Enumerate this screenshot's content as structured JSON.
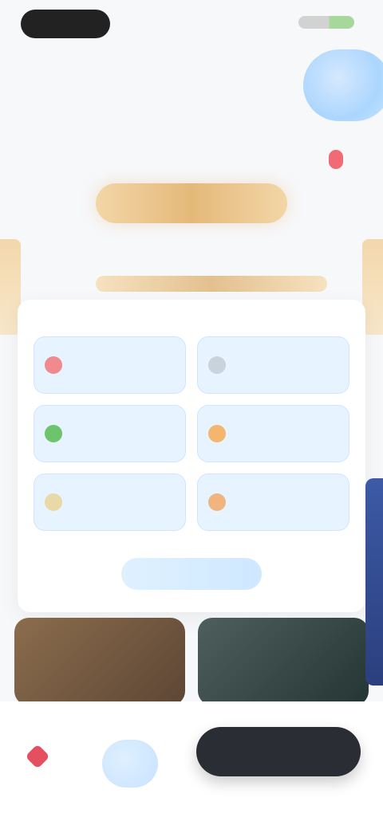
{
  "header": {
    "title": ""
  },
  "tags": {
    "left": "",
    "right": ""
  },
  "row": {
    "left": "",
    "right": ""
  },
  "card": {
    "title": "",
    "options": [
      {
        "label": "",
        "color": "#f08a8f"
      },
      {
        "label": "",
        "color": "#c9d3dc"
      },
      {
        "label": "",
        "color": "#6cc46b"
      },
      {
        "label": "",
        "color": "#f2b66e"
      },
      {
        "label": "",
        "color": "#e8d9a6"
      },
      {
        "label": "",
        "color": "#f0b57e"
      }
    ],
    "link": ""
  },
  "footer": {
    "like": "",
    "cta": ""
  },
  "colors": {
    "accent": "#e4b97a",
    "blue_light": "#e7f4ff",
    "cta_bg": "#2a2d33"
  }
}
